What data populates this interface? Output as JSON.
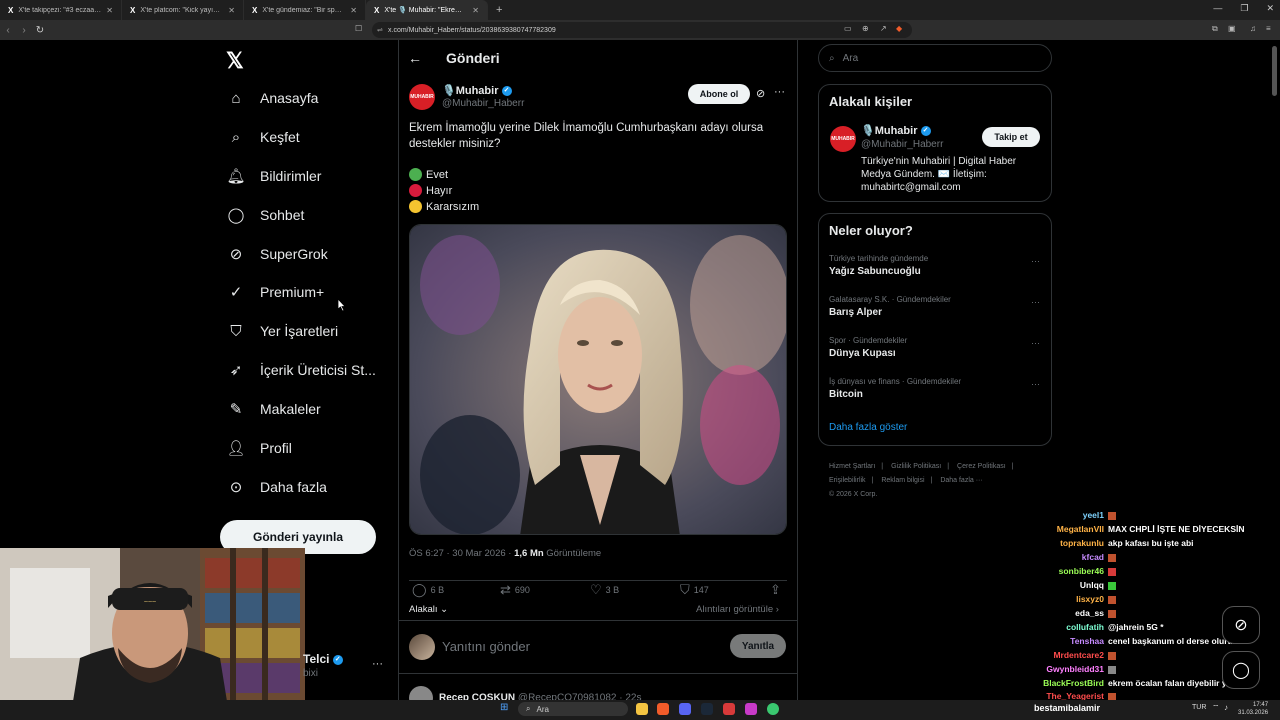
{
  "browser": {
    "tabs": [
      {
        "label": "X'te takipçezi: \"#3 eczaagurozel (Ö…"
      },
      {
        "label": "X'te platcom: \"Kick yayıncısı skyrain…"
      },
      {
        "label": "X'te gündemiaz: \"Bir spor salonu zinc…"
      },
      {
        "label": "X'te 🎙️ Muhabir: \"Ekrem İmamoğ…"
      }
    ],
    "url": "x.com/Muhabir_Haberr/status/2038639380747782309"
  },
  "nav": {
    "items": [
      {
        "label": "Anasayfa",
        "icon": "home-icon"
      },
      {
        "label": "Keşfet",
        "icon": "search-icon"
      },
      {
        "label": "Bildirimler",
        "icon": "bell-icon"
      },
      {
        "label": "Sohbet",
        "icon": "chat-icon"
      },
      {
        "label": "SuperGrok",
        "icon": "grok-icon"
      },
      {
        "label": "Premium+",
        "icon": "premium-icon"
      },
      {
        "label": "Yer İşaretleri",
        "icon": "bookmark-icon"
      },
      {
        "label": "İçerik Üreticisi St...",
        "icon": "rocket-icon"
      },
      {
        "label": "Makaleler",
        "icon": "article-icon"
      },
      {
        "label": "Profil",
        "icon": "profile-icon"
      },
      {
        "label": "Daha fazla",
        "icon": "more-circle-icon"
      }
    ],
    "post_button": "Gönderi yayınla",
    "account_name": "Telci",
    "account_handle": "bixi"
  },
  "header": {
    "title": "Gönderi"
  },
  "post": {
    "author_name": "🎙️Muhabir",
    "author_handle": "@Muhabir_Haberr",
    "avatar_text": "MUHABIR",
    "subscribe_label": "Abone ol",
    "text": "Ekrem İmamoğlu yerine Dilek İmamoğlu Cumhurbaşkanı adayı olursa destekler misiniz?",
    "options": [
      {
        "label": "Evet",
        "color": "#4caf50"
      },
      {
        "label": "Hayır",
        "color": "#d81b3c"
      },
      {
        "label": "Kararsızım",
        "color": "#f4c430"
      }
    ],
    "time": "ÖS 6:27 · 30 Mar 2026 · ",
    "views": "1,6 Mn",
    "views_label": " Görüntüleme",
    "replies": "6 B",
    "reposts": "690",
    "likes": "3 B",
    "bookmarks": "147",
    "relevant_label": "Alakalı",
    "quotes_label": "Alıntıları görüntüle",
    "reply_placeholder": "Yanıtını gönder",
    "reply_button": "Yanıtla",
    "next_reply_name": "Recep COŞKUN",
    "next_reply_handle": "@RecepCO70981082 · 22s"
  },
  "right": {
    "search_placeholder": "Ara",
    "related_title": "Alakalı kişiler",
    "related_name": "🎙️Muhabir",
    "related_handle": "@Muhabir_Haberr",
    "follow_label": "Takip et",
    "related_bio": "Türkiye'nin Muhabiri | Digital Haber Medya Gündem. ✉️ İletişim: muhabirtc@gmail.com",
    "trends_title": "Neler oluyor?",
    "trends": [
      {
        "category": "Türkiye tarihinde gündemde",
        "name": "Yağız Sabuncuoğlu"
      },
      {
        "category": "Galatasaray S.K. · Gündemdekiler",
        "name": "Barış Alper"
      },
      {
        "category": "Spor · Gündemdekiler",
        "name": "Dünya Kupası"
      },
      {
        "category": "İş dünyası ve finans · Gündemdekiler",
        "name": "Bitcoin"
      }
    ],
    "show_more": "Daha fazla göster",
    "footer": [
      "Hizmet Şartları",
      "|",
      "Gizlilik Politikası",
      "|",
      "Çerez Politikası",
      "|",
      "Erişilebilirlik",
      "|",
      "Reklam bilgisi",
      "|",
      "Daha fazla ···",
      "© 2026 X Corp."
    ]
  },
  "chat": [
    {
      "user": "yeel1",
      "msg": "",
      "color": "#7fd3ff",
      "emote": true
    },
    {
      "user": "MegatlanVII",
      "msg": "MAX CHPLİ İŞTE NE DİYECEKSİN",
      "color": "#ffb347",
      "emote": false
    },
    {
      "user": "toprakunlu",
      "msg": "akp kafası bu işte abi",
      "color": "#ffb347",
      "emote": false
    },
    {
      "user": "kfcad",
      "msg": "",
      "color": "#c68bff",
      "emote": true
    },
    {
      "user": "sonbiber46",
      "msg": "",
      "color": "#9cff57",
      "emote": true
    },
    {
      "user": "Unlqq",
      "msg": "",
      "color": "#ffffff",
      "emote": true
    },
    {
      "user": "lisxyz0",
      "msg": "",
      "color": "#ffb347",
      "emote": true
    },
    {
      "user": "eda_ss",
      "msg": "",
      "color": "#ffffff",
      "emote": true
    },
    {
      "user": "collufatih",
      "msg": "@jahrein 5G *",
      "color": "#7fffd4",
      "emote": false
    },
    {
      "user": "Tenshaa",
      "msg": "cenel başkanum ol derse olurum",
      "color": "#c68bff",
      "emote": false
    },
    {
      "user": "Mrdentcare2",
      "msg": "",
      "color": "#ff4d4d",
      "emote": true
    },
    {
      "user": "Gwynbleidd31",
      "msg": "",
      "color": "#ff80ff",
      "emote": true
    },
    {
      "user": "BlackFrostBird",
      "msg": "ekrem öcalan falan diyebilir ya",
      "color": "#9cff57",
      "emote": false
    },
    {
      "user": "The_Yeagerist",
      "msg": "",
      "color": "#ff4d4d",
      "emote": true
    }
  ],
  "taskbar": {
    "search": "Ara",
    "streamer": "bestamibalamir",
    "lang": "TUR",
    "time": "17:47",
    "date": "31.03.2026"
  }
}
